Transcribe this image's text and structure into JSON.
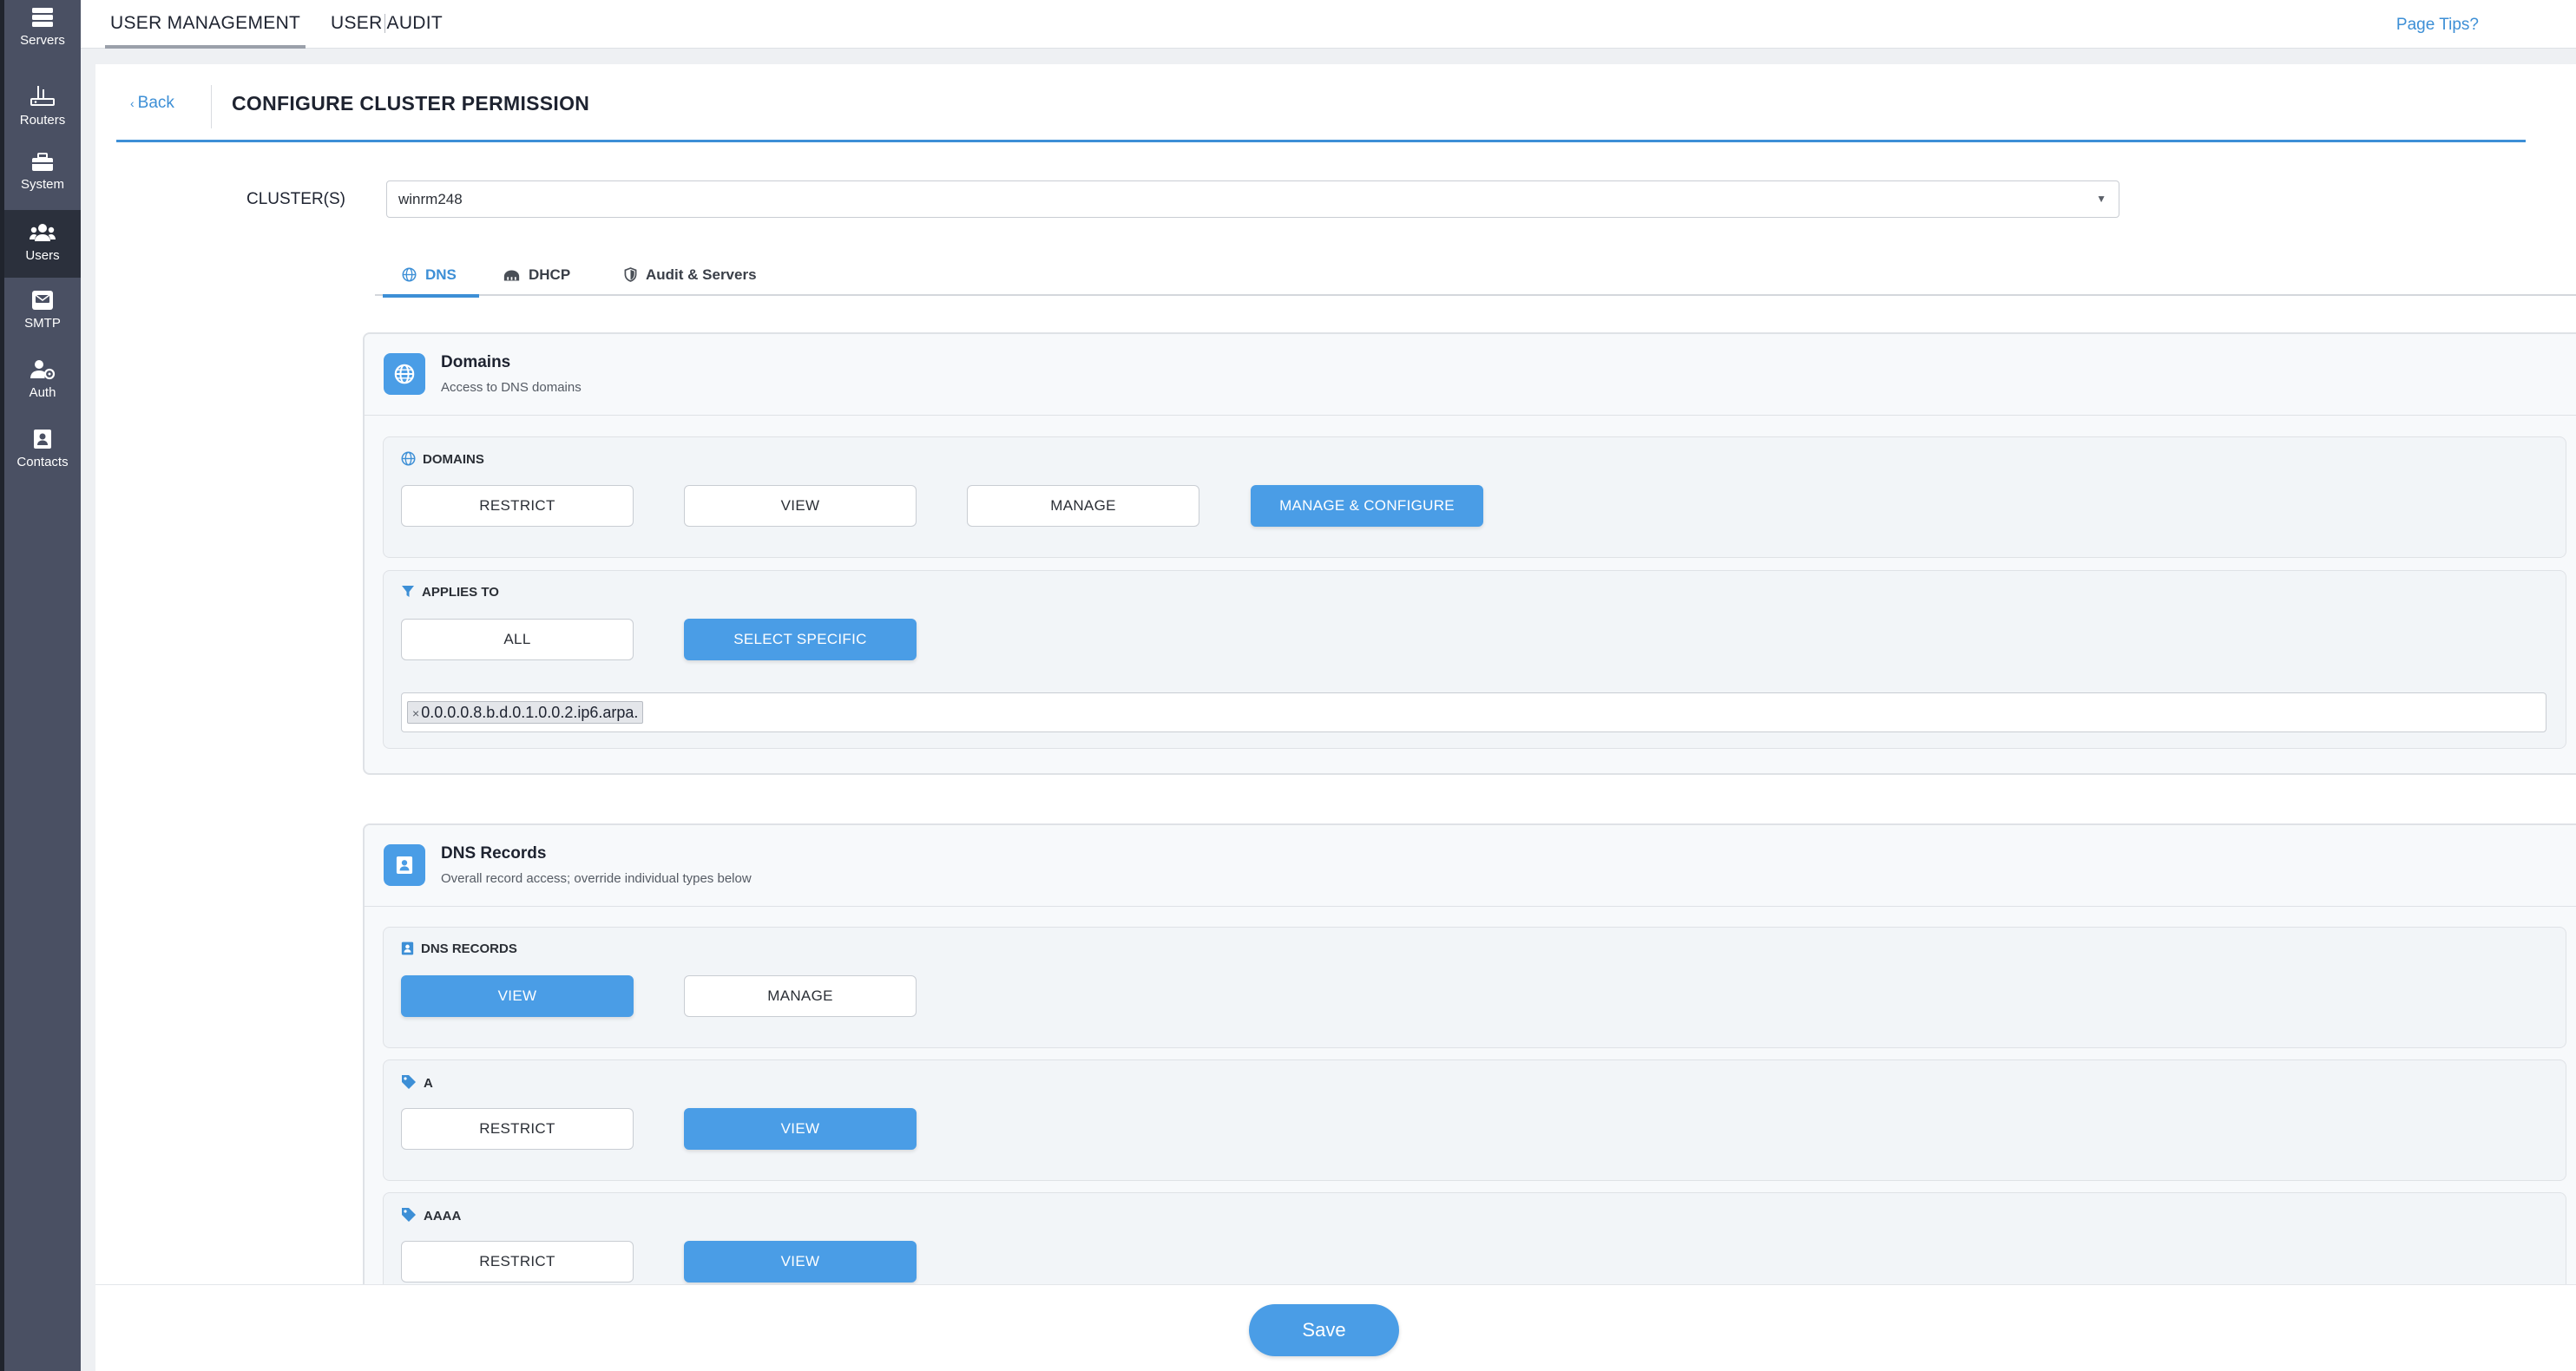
{
  "sidebar": {
    "items": [
      {
        "label": "Servers",
        "icon": "servers-icon"
      },
      {
        "label": "Routers",
        "icon": "routers-icon"
      },
      {
        "label": "System",
        "icon": "system-icon"
      },
      {
        "label": "Users",
        "icon": "users-icon",
        "active": true
      },
      {
        "label": "SMTP",
        "icon": "smtp-icon"
      },
      {
        "label": "Auth",
        "icon": "auth-icon"
      },
      {
        "label": "Contacts",
        "icon": "contacts-icon"
      }
    ]
  },
  "topbar": {
    "tabs": [
      {
        "label": "USER MANAGEMENT",
        "active": true
      },
      {
        "label": "USER AUDIT",
        "active": false
      }
    ],
    "page_tips": "Page Tips?"
  },
  "header": {
    "back_label": "Back",
    "title": "CONFIGURE CLUSTER PERMISSION"
  },
  "cluster": {
    "label": "CLUSTER(S)",
    "value": "winrm248"
  },
  "tabs": [
    {
      "label": "DNS",
      "icon": "globe-icon",
      "active": true
    },
    {
      "label": "DHCP",
      "icon": "dhcp-icon",
      "active": false
    },
    {
      "label": "Audit & Servers",
      "icon": "shield-icon",
      "active": false
    }
  ],
  "domains_section": {
    "title": "Domains",
    "subtitle": "Access to DNS domains",
    "domains_group": {
      "label": "DOMAINS",
      "options": [
        "RESTRICT",
        "VIEW",
        "MANAGE",
        "MANAGE & CONFIGURE"
      ],
      "selected": "MANAGE & CONFIGURE"
    },
    "applies_group": {
      "label": "APPLIES TO",
      "options": [
        "ALL",
        "SELECT SPECIFIC"
      ],
      "selected": "SELECT SPECIFIC",
      "tags": [
        "0.0.0.0.8.b.d.0.1.0.0.2.ip6.arpa."
      ]
    }
  },
  "records_section": {
    "title": "DNS Records",
    "subtitle": "Overall record access; override individual types below",
    "records_group": {
      "label": "DNS RECORDS",
      "options": [
        "VIEW",
        "MANAGE"
      ],
      "selected": "VIEW"
    },
    "a_group": {
      "label": "A",
      "options": [
        "RESTRICT",
        "VIEW"
      ],
      "selected": "VIEW"
    },
    "aaaa_group": {
      "label": "AAAA",
      "options": [
        "RESTRICT",
        "VIEW"
      ],
      "selected": "VIEW"
    }
  },
  "footer": {
    "save_label": "Save"
  },
  "colors": {
    "accent": "#4a9de6",
    "link": "#3d8fd6",
    "sidebar": "#4a5063",
    "sidebar_active": "#2b303c"
  }
}
